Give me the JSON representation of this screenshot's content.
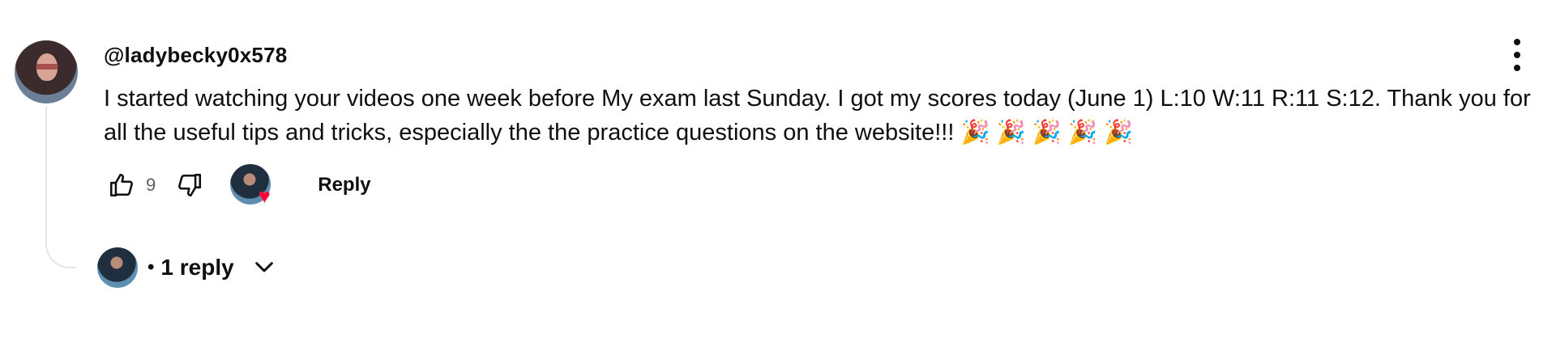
{
  "comment": {
    "author": "@ladybecky0x578",
    "text": "I started watching your videos one week before My exam last Sunday. I got my scores today (June 1)  L:10 W:11 R:11 S:12. Thank you for all the useful tips and tricks, especially the the practice questions on the website!!! 🎉 🎉 🎉 🎉 🎉",
    "like_count": "9",
    "reply_label": "Reply"
  },
  "replies": {
    "separator": "•",
    "label": "1 reply"
  },
  "icons": {
    "menu": "more-vertical-icon",
    "like": "thumb-up-icon",
    "dislike": "thumb-down-icon",
    "heart": "heart-icon",
    "chevron": "chevron-down-icon"
  },
  "colors": {
    "heart": "#ff0033",
    "text": "#0f0f0f",
    "muted": "#606060",
    "thread_line": "#e5e5e5"
  }
}
